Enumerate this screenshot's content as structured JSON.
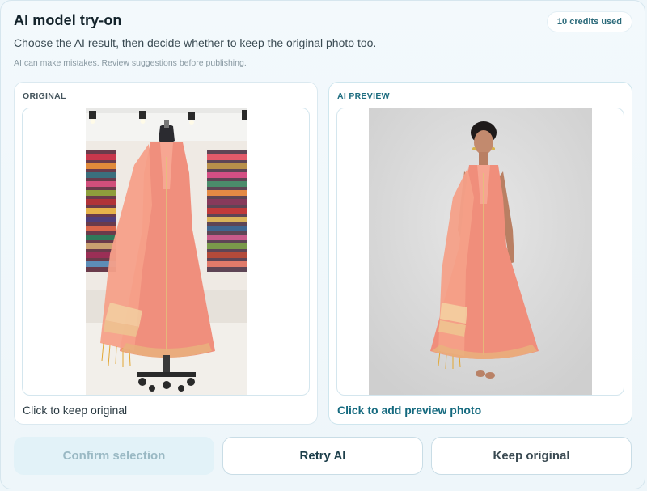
{
  "dialog": {
    "title": "AI model try-on",
    "credits_badge": "10 credits used",
    "subtitle": "Choose the AI result, then decide whether to keep the original photo too.",
    "disclaimer": "AI can make mistakes. Review suggestions before publishing."
  },
  "original_card": {
    "label": "ORIGINAL",
    "cta": "Click to keep original"
  },
  "preview_card": {
    "label": "AI PREVIEW",
    "cta": "Click to add preview photo"
  },
  "actions": {
    "confirm_label": "Confirm selection",
    "retry_label": "Retry AI",
    "keep_label": "Keep original"
  },
  "colors": {
    "accent": "#156a7f",
    "dress": "#f0907e",
    "disabled_button_bg": "#e2f2f8"
  }
}
